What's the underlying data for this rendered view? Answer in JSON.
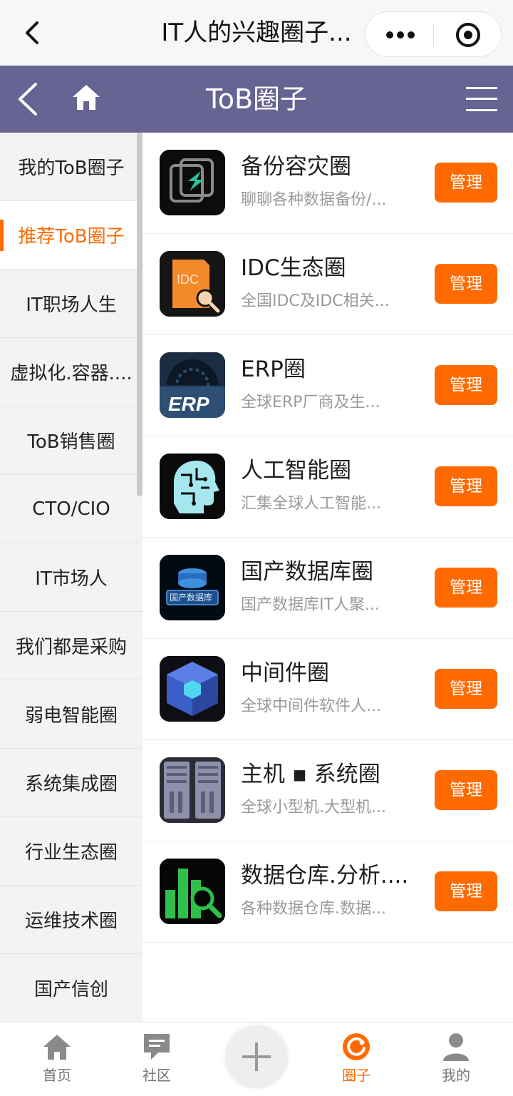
{
  "miniapp": {
    "title": "IT人的兴趣圈子..."
  },
  "header": {
    "title": "ToB圈子"
  },
  "sidebar": {
    "items": [
      {
        "label": "我的ToB圈子",
        "active": false
      },
      {
        "label": "推荐ToB圈子",
        "active": true
      },
      {
        "label": "IT职场人生",
        "active": false
      },
      {
        "label": "虚拟化.容器....",
        "active": false
      },
      {
        "label": "ToB销售圈",
        "active": false
      },
      {
        "label": "CTO/CIO",
        "active": false
      },
      {
        "label": "IT市场人",
        "active": false
      },
      {
        "label": "我们都是采购",
        "active": false
      },
      {
        "label": "弱电智能圈",
        "active": false
      },
      {
        "label": "系统集成圈",
        "active": false
      },
      {
        "label": "行业生态圈",
        "active": false
      },
      {
        "label": "运维技术圈",
        "active": false
      },
      {
        "label": "国产信创",
        "active": false
      }
    ]
  },
  "circles": [
    {
      "name": "备份容灾圈",
      "desc": "聊聊各种数据备份/...",
      "button": "管理",
      "icon": "backup-recovery-icon"
    },
    {
      "name": "IDC生态圈",
      "desc": "全国IDC及IDC相关...",
      "button": "管理",
      "icon": "idc-icon"
    },
    {
      "name": "ERP圈",
      "desc": "全球ERP厂商及生...",
      "button": "管理",
      "icon": "erp-icon"
    },
    {
      "name": "人工智能圈",
      "desc": "汇集全球人工智能...",
      "button": "管理",
      "icon": "ai-head-icon"
    },
    {
      "name": "国产数据库圈",
      "desc": "国产数据库IT人聚...",
      "button": "管理",
      "icon": "database-icon"
    },
    {
      "name": "中间件圈",
      "desc": "全球中间件软件人...",
      "button": "管理",
      "icon": "middleware-cube-icon"
    },
    {
      "name": "主机 ▪ 系统圈",
      "desc": "全球小型机.大型机...",
      "button": "管理",
      "icon": "server-icon"
    },
    {
      "name": "数据仓库.分析....",
      "desc": "各种数据仓库.数据...",
      "button": "管理",
      "icon": "data-analysis-icon"
    }
  ],
  "erp_icon_text": "ERP",
  "idc_icon_text": "IDC",
  "db_icon_text": "国产数据库",
  "tabbar": {
    "tabs": [
      {
        "label": "首页",
        "icon": "home-icon",
        "active": false
      },
      {
        "label": "社区",
        "icon": "chat-icon",
        "active": false
      },
      {
        "label": "圈子",
        "icon": "circle-icon",
        "active": true
      },
      {
        "label": "我的",
        "icon": "user-icon",
        "active": false
      }
    ]
  },
  "colors": {
    "header": "#676393",
    "accent": "#ff6a00"
  }
}
